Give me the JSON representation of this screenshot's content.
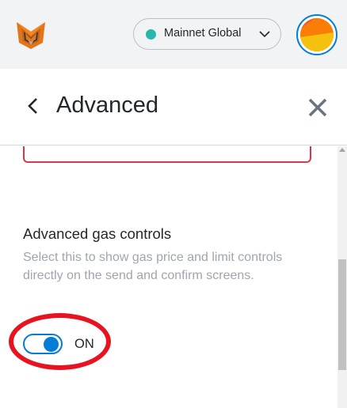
{
  "header": {
    "network": {
      "label": "Mainnet Global",
      "dot_color": "#29b6af",
      "chevron_icon": "chevron-down-icon"
    },
    "logo_icon": "metamask-fox-logo",
    "avatar_icon": "account-identicon"
  },
  "page": {
    "title": "Advanced",
    "back_icon": "chevron-left-icon",
    "close_icon": "close-icon"
  },
  "settings": {
    "gas_controls": {
      "title": "Advanced gas controls",
      "description": "Select this to show gas price and limit controls directly on the send and confirm screens.",
      "toggle_state": "ON"
    }
  },
  "colors": {
    "accent": "#037dd6",
    "error_border": "#d73a49",
    "annotation": "#e8131f",
    "header_bg": "#f2f3f4"
  }
}
